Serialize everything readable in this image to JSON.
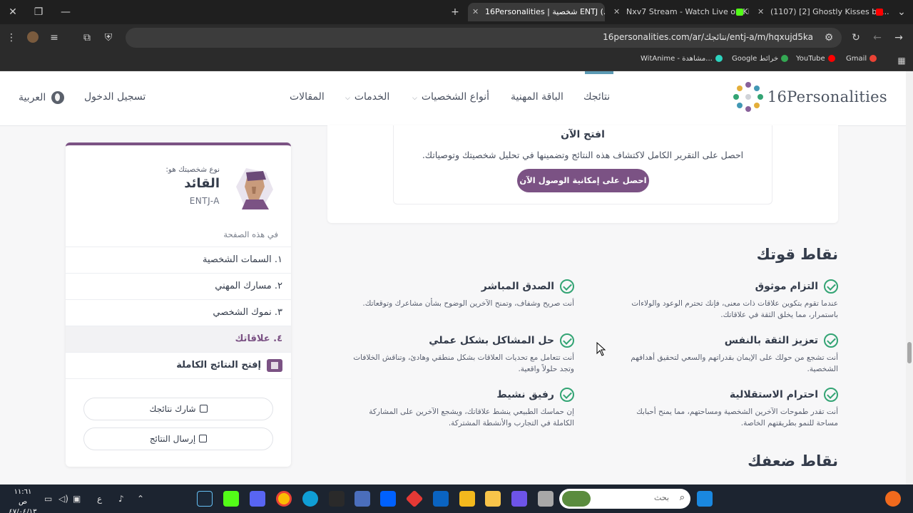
{
  "browser": {
    "tabs": [
      {
        "title": "16Personalities | شخصية ENTJ (..."
      },
      {
        "title": "Nxv7 Stream - Watch Live on Ki..."
      },
      {
        "title": "(1107) [2] Ghostly Kisses bu..."
      }
    ],
    "url": "16personalities.com/ar/نتائجك/entj-a/m/hqxujd5ka",
    "bookmarks": [
      "Gmail",
      "YouTube",
      "Google خرائط",
      "WitAnime - مشاهدة..."
    ]
  },
  "header": {
    "logo_text": "16Personalities",
    "nav": [
      "نتائجك",
      "الباقة المهنية",
      "أنواع الشخصيات",
      "الخدمات",
      "المقالات"
    ],
    "login": "تسجيل الدخول",
    "language": "العربية"
  },
  "unlock": {
    "title": "افتح الآن",
    "description": "احصل على التقرير الكامل لاكتشاف هذه النتائج وتضمينها في تحليل شخصيتك وتوصياتك.",
    "button": "احصل على إمكانية الوصول الآن"
  },
  "strengths": {
    "title": "نقاط قوتك",
    "items": [
      {
        "title": "التزام موثوق",
        "desc": "عندما تقوم بتكوين علاقات ذات معنى، فإنك تحترم الوعود والولاءات باستمرار، مما يخلق الثقة في علاقاتك."
      },
      {
        "title": "الصدق المباشر",
        "desc": "أنت صريح وشفاف، وتمنح الآخرين الوضوح بشأن مشاعرك وتوقعاتك."
      },
      {
        "title": "تعزيز الثقة بالنفس",
        "desc": "أنت تشجع من حولك على الإيمان بقدراتهم والسعي لتحقيق أهدافهم الشخصية."
      },
      {
        "title": "حل المشاكل بشكل عملي",
        "desc": "أنت تتعامل مع تحديات العلاقات بشكل منطقي وهادئ، وتناقش الخلافات وتجد حلولاً واقعية."
      },
      {
        "title": "احترام الاستقلالية",
        "desc": "أنت تقدر طموحات الآخرين الشخصية ومساحتهم، مما يمنح أحبابك مساحة للنمو بطريقتهم الخاصة."
      },
      {
        "title": "رفيق نشيط",
        "desc": "إن حماسك الطبيعي ينشط علاقاتك، ويشجع الآخرين على المشاركة الكاملة في التجارب والأنشطة المشتركة."
      }
    ]
  },
  "weaknesses": {
    "title": "نقاط ضعفك"
  },
  "sidebar": {
    "type_label": "نوع شخصيتك هو:",
    "type_name": "القائد",
    "type_code": "ENTJ-A",
    "toc_title": "في هذه الصفحة",
    "toc": [
      "١. السمات الشخصية",
      "٢. مسارك المهني",
      "٣. نموك الشخصي",
      "٤. علاقاتك"
    ],
    "unlock_full": "إفتح النتائج الكاملة",
    "share": "شارك نتائجك",
    "send": "إرسال النتائج"
  },
  "taskbar": {
    "search_placeholder": "بحث",
    "time": "١١:٦١ ص",
    "date": "٤٧/٠٤/١٣"
  },
  "colors": {
    "accent": "#7b5284",
    "check": "#33a474"
  }
}
